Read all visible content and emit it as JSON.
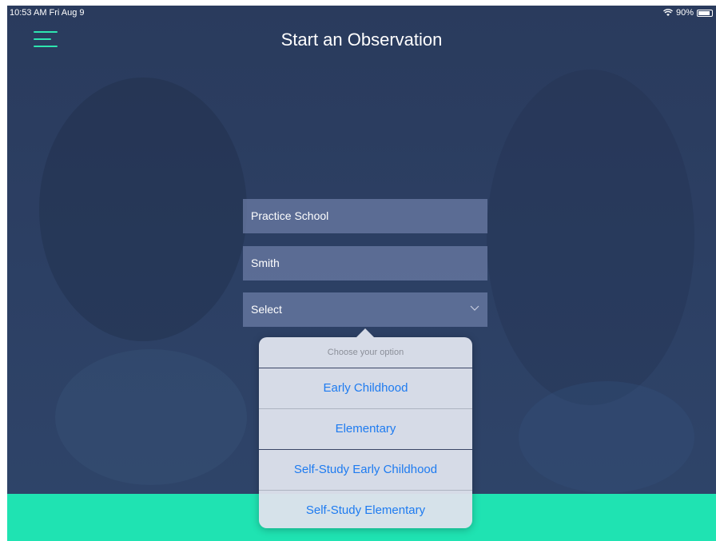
{
  "status_bar": {
    "time": "10:53 AM  Fri Aug 9",
    "wifi_icon": "wifi-icon",
    "battery": "90%",
    "battery_level": 0.9
  },
  "header": {
    "title": "Start an Observation",
    "menu_icon": "hamburger-menu-icon"
  },
  "form": {
    "school_value": "Practice School",
    "name_value": "Smith",
    "program_select_value": "Select"
  },
  "picker": {
    "title": "Choose your option",
    "options": [
      "Early Childhood",
      "Elementary",
      "Self-Study Early Childhood",
      "Self-Study Elementary"
    ]
  },
  "colors": {
    "accent": "#1fe3b2",
    "menu_accent": "#2ee6b0",
    "option_text": "#1e7bf0"
  }
}
